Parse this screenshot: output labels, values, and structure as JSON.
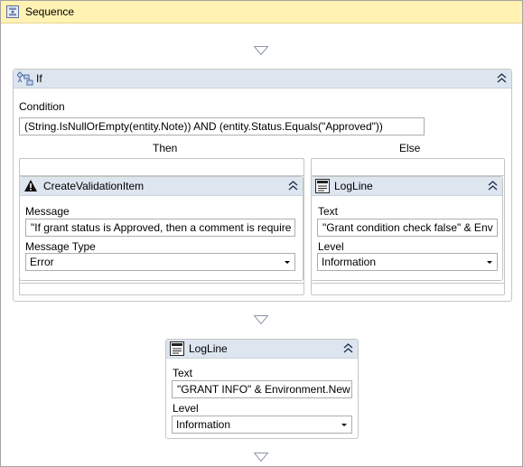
{
  "sequence": {
    "title": "Sequence",
    "icon": "sequence-icon"
  },
  "if_activity": {
    "title": "If",
    "icon": "if-activity-icon",
    "condition_label": "Condition",
    "condition_value": "(String.IsNullOrEmpty(entity.Note)) AND (entity.Status.Equals(\"Approved\"))",
    "then_label": "Then",
    "else_label": "Else"
  },
  "create_validation": {
    "title": "CreateValidationItem",
    "icon": "warning-icon",
    "message_label": "Message",
    "message_value": "\"If grant status is Approved, then a comment is require",
    "message_type_label": "Message Type",
    "message_type_value": "Error"
  },
  "else_logline": {
    "title": "LogLine",
    "icon": "logline-icon",
    "text_label": "Text",
    "text_value": "\"Grant condition check false\" & Env",
    "level_label": "Level",
    "level_value": "Information"
  },
  "bottom_logline": {
    "title": "LogLine",
    "icon": "logline-icon",
    "text_label": "Text",
    "text_value": "\"GRANT INFO\" & Environment.New",
    "level_label": "Level",
    "level_value": "Information"
  }
}
